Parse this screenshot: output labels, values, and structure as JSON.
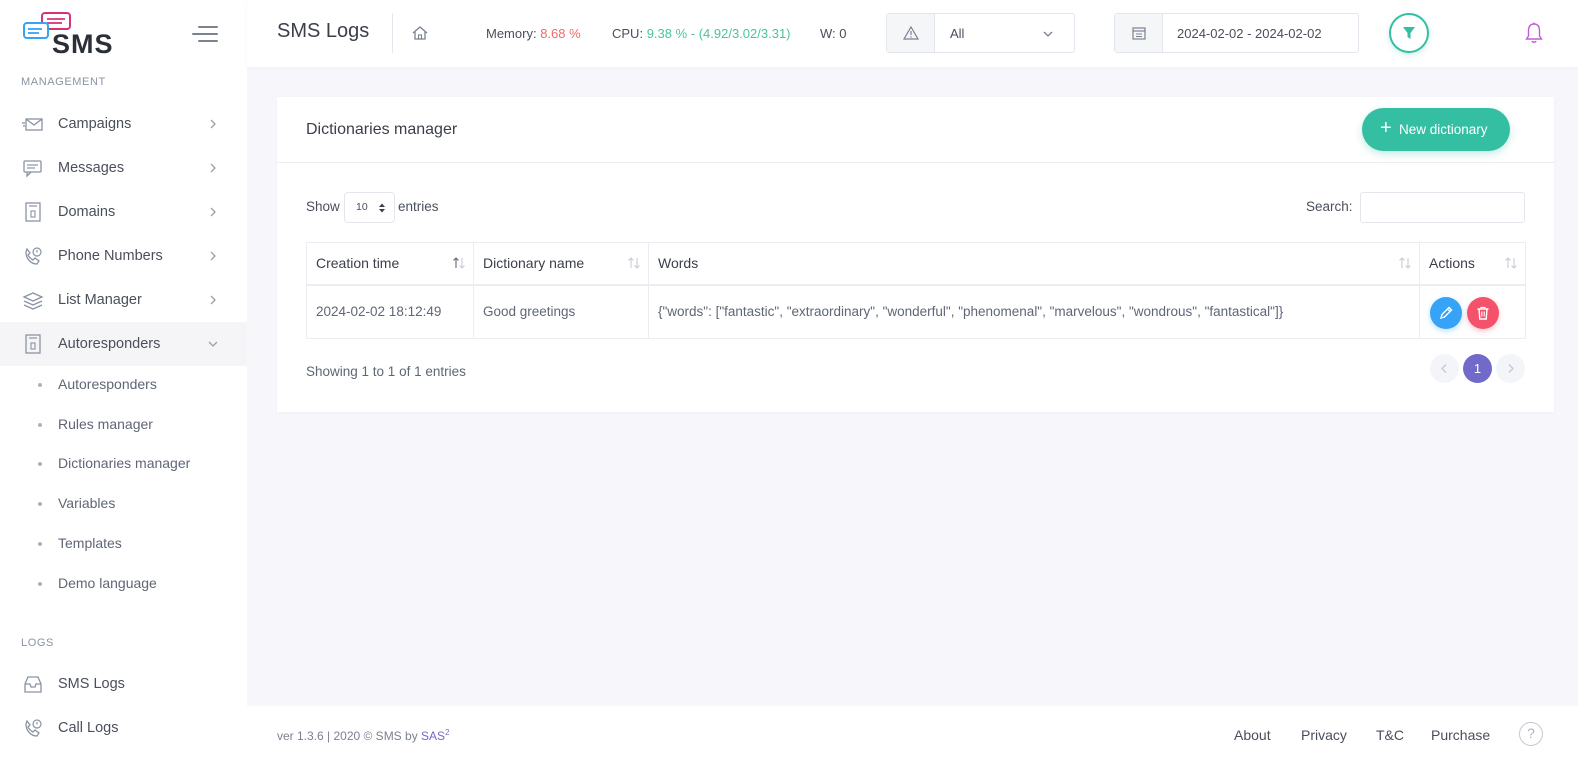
{
  "app": {
    "logo_text": "SMS",
    "colors": {
      "accent": "#34bfa3",
      "brand": "#716aca",
      "danger": "#f4516c",
      "info": "#36a3f7",
      "logo": "#d9307c"
    }
  },
  "sidebar": {
    "sections": {
      "management": "MANAGEMENT",
      "logs": "LOGS"
    },
    "items": [
      {
        "label": "Campaigns",
        "icon": "envelope-icon"
      },
      {
        "label": "Messages",
        "icon": "chat-icon"
      },
      {
        "label": "Domains",
        "icon": "document-icon"
      },
      {
        "label": "Phone Numbers",
        "icon": "phone-icon"
      },
      {
        "label": "List Manager",
        "icon": "layers-icon"
      },
      {
        "label": "Autoresponders",
        "icon": "document-icon",
        "expanded": true
      }
    ],
    "sub_items": [
      "Autoresponders",
      "Rules manager",
      "Dictionaries manager",
      "Variables",
      "Templates",
      "Demo language"
    ],
    "logs_items": [
      {
        "label": "SMS Logs",
        "icon": "inbox-icon"
      },
      {
        "label": "Call Logs",
        "icon": "phone-icon"
      }
    ]
  },
  "topbar": {
    "title": "SMS Logs",
    "memory_label": "Memory:",
    "memory_value": "8.68 %",
    "cpu_label": "CPU:",
    "cpu_value": "9.38 % - (4.92/3.02/3.31)",
    "workers": "W: 0",
    "level_filter": "All",
    "date_range": "2024-02-02 - 2024-02-02"
  },
  "main": {
    "card_title": "Dictionaries manager",
    "new_button": "New dictionary",
    "show_label": "Show",
    "entries_value": "10",
    "entries_label": "entries",
    "search_label": "Search:",
    "search_value": "",
    "table": {
      "columns": [
        "Creation time",
        "Dictionary name",
        "Words",
        "Actions"
      ],
      "rows": [
        {
          "creation_time": "2024-02-02 18:12:49",
          "name": "Good greetings",
          "words": "{\"words\": [\"fantastic\", \"extraordinary\", \"wonderful\", \"phenomenal\", \"marvelous\", \"wondrous\", \"fantastical\"]}"
        }
      ]
    },
    "info": "Showing 1 to 1 of 1 entries",
    "current_page": "1"
  },
  "footer": {
    "version_text": "ver 1.3.6 | 2020 © SMS by ",
    "brand": "SAS",
    "brand_sup": "2",
    "links": [
      "About",
      "Privacy",
      "T&C",
      "Purchase"
    ],
    "help": "?"
  }
}
